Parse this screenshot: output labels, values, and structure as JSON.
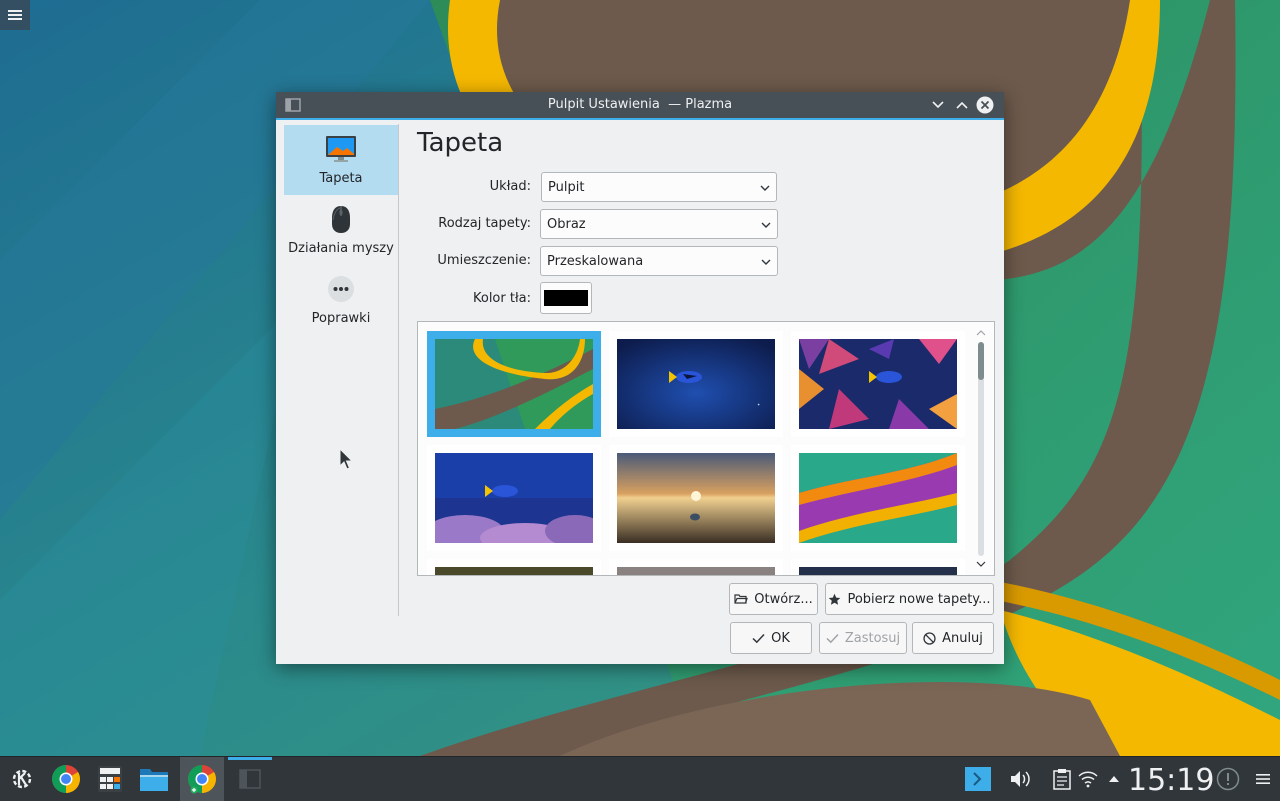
{
  "dialog": {
    "title": "Pulpit Ustawienia  — Plazma",
    "page_title": "Tapeta",
    "sidebar": [
      {
        "label": "Tapeta",
        "icon": "monitor-icon",
        "selected": true
      },
      {
        "label": "Działania myszy",
        "icon": "mouse-icon",
        "selected": false
      },
      {
        "label": "Poprawki",
        "icon": "more-icon",
        "selected": false
      }
    ],
    "form": {
      "layout_label": "Układ:",
      "layout_value": "Pulpit",
      "type_label": "Rodzaj tapety:",
      "type_value": "Obraz",
      "position_label": "Umieszczenie:",
      "position_value": "Przeskalowana",
      "color_label": "Kolor tła:",
      "color_value": "#000000"
    },
    "buttons": {
      "open": "Otwórz...",
      "get_new": "Pobierz nowe tapety...",
      "ok": "OK",
      "apply": "Zastosuj",
      "cancel": "Anuluj"
    }
  },
  "taskbar": {
    "clock": "15:19",
    "apps": [
      "kde-launcher-icon",
      "chrome-icon",
      "calculator-icon",
      "file-manager-icon",
      "chrome-icon"
    ],
    "tray": [
      "terminal-icon",
      "volume-icon",
      "clipboard-icon",
      "wifi-icon",
      "arrow-up-icon",
      "notifications-icon",
      "menu-icon"
    ]
  },
  "colors": {
    "accent": "#3daee9",
    "titlebar": "#475057",
    "taskbar": "#31363b",
    "window_bg": "#eff0f1"
  }
}
